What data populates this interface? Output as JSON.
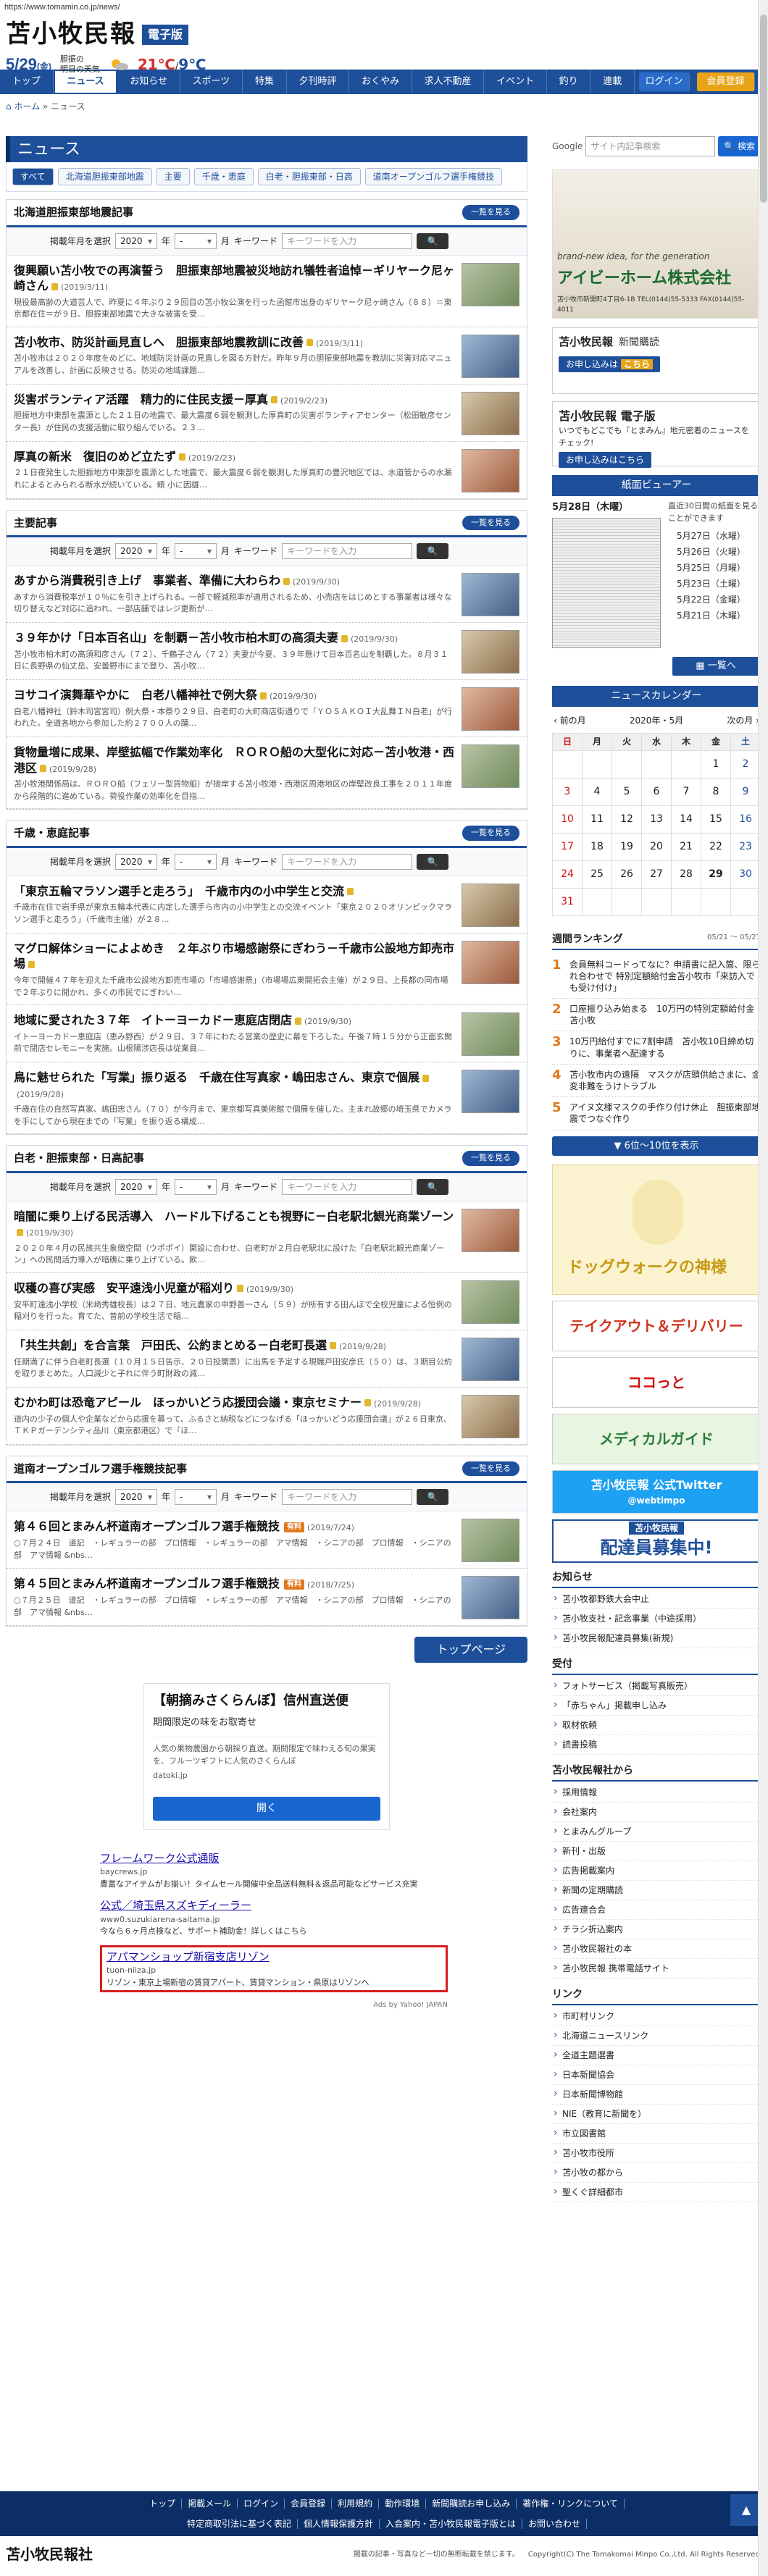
{
  "url": "https://www.tomamin.co.jp/news/",
  "header": {
    "logo_main": "苫小牧民報",
    "logo_badge": "電子版",
    "date": "5/29",
    "weekday": "(金)",
    "weather_src_1": "胆振の",
    "weather_src_2": "明日の天気",
    "temp_high": "21℃",
    "temp_sep": "/",
    "temp_low": "9℃"
  },
  "nav": {
    "items": [
      "トップ",
      "ニュース",
      "お知らせ",
      "スポーツ",
      "特集",
      "夕刊時評",
      "おくやみ",
      "求人不動産",
      "イベント",
      "釣り",
      "連載"
    ],
    "login": "ログイン",
    "member": "会員登録"
  },
  "breadcrumb": {
    "home": "ホーム",
    "sep": "»",
    "current": "ニュース"
  },
  "page_title": "ニュース",
  "subnav": [
    "すべて",
    "北海道胆振東部地震",
    "主要",
    "千歳・恵庭",
    "白老・胆振東部・日高",
    "道南オープンゴルフ選手権競技"
  ],
  "filter": {
    "label": "掲載年月を選択",
    "year": "2020",
    "year_unit": "年",
    "month": "-",
    "month_unit": "月",
    "kw_label": "キーワード",
    "kw_placeholder": "キーワードを入力",
    "list_btn": "一覧を見る"
  },
  "blocks": [
    {
      "title": "北海道胆振東部地震記事",
      "articles": [
        {
          "title": "復興願い苫小牧での再演誓う　胆振東部地震被災地訪れ犠牲者追悼－ギリヤーク尼ヶ崎さん",
          "date": "(2019/3/11)",
          "lock": true,
          "summary": "現役最高齢の大道芸人で、昨夏に４年ぶり２９回目の苫小牧公演を行った函館市出身のギリヤーク尼ヶ崎さん（８８）＝東京都在住＝が９日、胆振東部地震で大きな被害を受…"
        },
        {
          "title": "苫小牧市、防災計画見直しへ　胆振東部地震教訓に改善",
          "date": "(2019/3/11)",
          "lock": true,
          "summary": "苫小牧市は２０２０年度をめどに、地域防災計画の見直しを図る方針だ。昨年９月の胆振東部地震を教訓に災害対応マニュアルを改善し、計画に反映させる。防災の地域課題…"
        },
        {
          "title": "災害ボランティア活躍　精力的に住民支援－厚真",
          "date": "(2019/2/23)",
          "lock": true,
          "summary": "胆振地方中東部を震源とした２１日の地震で、最大震度６弱を観測した厚真町の災害ボランティアセンター（松田敏彦センター長）が住民の支援活動に取り組んでいる。２３…"
        },
        {
          "title": "厚真の新米　復旧のめど立たず",
          "date": "(2019/2/23)",
          "lock": true,
          "summary": "２１日夜発生した胆振地方中東部を震源とした地震で、最大震度６弱を観測した厚真町の豊沢地区では、水道管からの水漏れによるとみられる断水が続いている。頼 小に因雄…"
        }
      ]
    },
    {
      "title": "主要記事",
      "articles": [
        {
          "title": "あすから消費税引き上げ　事業者、準備に大わらわ",
          "date": "(2019/9/30)",
          "lock": true,
          "summary": "あすから消費税率が１０％にを引き上げられる。一部で軽減税率が適用されるため、小売店をはじめとする事業者は様々な切り替えなど対応に追われ、一部店舗ではレジ更新が…"
        },
        {
          "title": "３９年かけ「日本百名山」を制覇－苫小牧市柏木町の高須夫妻",
          "date": "(2019/9/30)",
          "lock": true,
          "summary": "苫小牧市柏木町の高須和彦さん（７２）、千鶴子さん（７２）夫妻が今夏、３９年懸けて日本百名山を制覇した。８月３１日に長野県の仙丈岳、安曇野市にまで登り、苫小牧…"
        },
        {
          "title": "ヨサコイ演舞華やかに　白老八幡神社で例大祭",
          "date": "(2019/9/30)",
          "lock": true,
          "summary": "白老八幡神社（鈴木司宮宮司）例大祭・本祭り２９日、白老町の大町商店街通りで「ＹＯＳＡＫＯＩ大乱舞ＩＮ白老」が行われた。全道各地から参加した約２７００人の踊…"
        },
        {
          "title": "貨物量増に成果、岸壁拡幅で作業効率化　ＲＯＲＯ船の大型化に対応－苫小牧港・西港区",
          "date": "(2019/9/28)",
          "lock": true,
          "summary": "苫小牧港関係局は、ＲＯＲＯ船（フェリー型貨物船）が接岸する苫小牧港・西港区周港地区の岸壁改良工事を２０１１年度から段階的に進めている。荷役作業の効率化を目指…"
        }
      ]
    },
    {
      "title": "千歳・恵庭記事",
      "articles": [
        {
          "title": "「東京五輪マラソン選手と走ろう」　千歳市内の小中学生と交流",
          "date": "",
          "lock": true,
          "summary": "千歳市在住で岩手県が東京五輪本代表に内定した選手ら市内の小中学生との交流イベント「東京２０２０オリンピックマラソン選手と走ろう」（千歳市主催）が２８…"
        },
        {
          "title": "マグロ解体ショーによよめき　２年ぶり市場感謝祭にぎわう－千歳市公設地方卸売市場",
          "date": "",
          "lock": true,
          "summary": "今年で開催４７年を迎えた千歳市公設地方卸売市場の「市場感謝祭」（市場場広東開拓会主催）が２９日、上長都の同市場で２年ぶりに開かれ、多くの市民でにぎわい…"
        },
        {
          "title": "地域に愛された３７年　イトーヨーカドー恵庭店閉店",
          "date": "(2019/9/30)",
          "lock": true,
          "summary": "イトーヨーカドー恵庭店（恵み野西）が２９日、３７年にわたる営業の歴史に幕を下ろした。午後７時１５分から正面玄関前で閉店セレモニーを実施。山根陽渉店長は従業員…"
        },
        {
          "title": "鳥に魅せられた「写業」振り返る　千歳在住写真家・嶋田忠さん、東京で個展",
          "date": "(2019/9/28)",
          "lock": true,
          "summary": "千歳在住の自然写真家、嶋田忠さん（７０）が今月まで、東京都写真美術館で個展を催した。主まれ故郷の埼玉県でカメラを手にしてから現在までの「写業」を振り返る構成…"
        }
      ]
    },
    {
      "title": "白老・胆振東部・日高記事",
      "articles": [
        {
          "title": "暗闇に乗り上げる民活導入　ハードル下げることも視野に－白老駅北観光商業ゾーン",
          "date": "(2019/9/30)",
          "lock": true,
          "summary": "２０２０年４月の民族共生象徴空間（ウポポイ）開設に合わせ、白老町が２月白老駅北に設けた「白老駅北観光商業ゾーン」への民間活力導入が暗礁に乗り上げている。飲…"
        },
        {
          "title": "収穫の喜び実感　安平遠浅小児童が稲刈り",
          "date": "(2019/9/30)",
          "lock": true,
          "summary": "安平町遠浅小学校（米崎秀雄校長）は２７日、地元農家の中野善一さん（５９）が所有する田んぼで全校児童による恒例の稲刈りを行った。育てた、昔前の学校生活で稲…"
        },
        {
          "title": "「共生共創」を合言葉　戸田氏、公約まとめる－白老町長選",
          "date": "(2019/9/28)",
          "lock": true,
          "summary": "任期満了に伴う白老町長選（１０月１５日告示、２０日投開票）に出馬を予定する現職戸田安彦氏（５０）は、３期目公約を取りまとめた。人口減少と子れに伴う町財政の減…"
        },
        {
          "title": "むかわ町は恐竜アピール　ほっかいどう応援団会議・東京セミナー",
          "date": "(2019/9/28)",
          "lock": true,
          "summary": "道内の少子の個人や企業などから応援を募って、ふるさと納税などにつなげる「ほっかいどう応援団会議」が２６日東京、ＴＫＰガーデンシティ品川（東京都港区）で「ほ…"
        }
      ]
    },
    {
      "title": "道南オープンゴルフ選手権競技記事",
      "articles": [
        {
          "title": "第４６回とまみん杯道南オープンゴルフ選手権競技",
          "date": "(2019/7/24)",
          "lock": false,
          "paid": "有料",
          "summary": "○７月２４日　道記　・レギュラーの部　プロ情報　・レギュラーの部　アマ情報　・シニアの部　プロ情報　・シニアの部　アマ情報 &nbs…"
        },
        {
          "title": "第４５回とまみん杯道南オープンゴルフ選手権競技",
          "date": "(2018/7/25)",
          "lock": false,
          "paid": "有料",
          "summary": "○７月２５日　道記　・レギュラーの部　プロ情報　・レギュラーの部　アマ情報　・シニアの部　プロ情報　・シニアの部　アマ情報 &nbs…"
        }
      ]
    }
  ],
  "top_page_btn": "トップページ",
  "ad1": {
    "title": "【朝摘みさくらんぼ】信州直送便",
    "sub": "期間限定の味をお取寄せ",
    "body": "人気の果物農園から朝採り直送。期間限定で味わえる旬の果実を、フルーツギフトに人気のさくらんぼ",
    "url": "datoki.jp",
    "btn": "開く"
  },
  "ydn": [
    {
      "title": "フレームワーク公式通販",
      "url": "baycrews.jp",
      "desc": "豊富なアイテムがお揃い！タイムセール開催中全品送料無料＆返品可能などサービス充実"
    },
    {
      "title": "公式／埼玉県スズキディーラー",
      "url": "www0.suzukiarena-saitama.jp",
      "desc": "今なら６ヶ月点検など、サポート補助金！詳しくはこちら"
    },
    {
      "title": "アパマンショップ新宿支店リゾン",
      "url": "tuon-niiza.jp",
      "desc": "リゾン・東京上場新宿の賃貸アパート、賃貸マンション・県原はリゾンへ"
    }
  ],
  "ydn_src": "Ads by Yahoo! JAPAN",
  "side": {
    "google": "Google",
    "search_placeholder": "サイト内記事検索",
    "search_btn": "検索",
    "ad_tag": "brand-new idea, for the generation",
    "ad_brand": "アイビーホーム株式会社",
    "ad_tel": "苫小牧市新開町4丁目6-1B TEL(0144)55-5333 FAX(0144)55-4011",
    "subscribe_logo": "苫小牧民報",
    "subscribe_title": "新聞購読",
    "subscribe_cta": "お申し込みは",
    "subscribe_cta_b": "こちら",
    "digital_logo": "苫小牧民報 電子版",
    "digital_desc": "いつでもどこでも『とまみん』地元密着のニュースをチェック!",
    "digital_cta": "お申し込みはこちら",
    "viewer_head": "紙面ビューアー",
    "viewer_today": "5月28日（木曜）",
    "viewer_note": "直近30日間の紙面を見ることができます",
    "viewer_dates": [
      "5月27日（水曜）",
      "5月26日（火曜）",
      "5月25日（月曜）",
      "5月23日（土曜）",
      "5月22日（金曜）",
      "5月21日（木曜）"
    ],
    "viewer_list_btn": "一覧へ",
    "cal_head": "ニュースカレンダー",
    "cal_prev": "‹ 前の月",
    "cal_month": "2020年・5月",
    "cal_next": "次の月 ›",
    "cal_weekdays": [
      "日",
      "月",
      "火",
      "水",
      "木",
      "金",
      "土"
    ],
    "cal_rows": [
      [
        "",
        "",
        "",
        "",
        "",
        "1",
        "2"
      ],
      [
        "3",
        "4",
        "5",
        "6",
        "7",
        "8",
        "9"
      ],
      [
        "10",
        "11",
        "12",
        "13",
        "14",
        "15",
        "16"
      ],
      [
        "17",
        "18",
        "19",
        "20",
        "21",
        "22",
        "23"
      ],
      [
        "24",
        "25",
        "26",
        "27",
        "28",
        "29",
        "30"
      ],
      [
        "31",
        "",
        "",
        "",
        "",
        "",
        ""
      ]
    ],
    "rank_title": "週間ランキング",
    "rank_range": "05/21 〜 05/27",
    "rank": [
      "会員無料コードってなに？申請書に記入箇、限られ合わせで 特別定額給付金苫小牧市「来訪入でも受け付け」",
      "口座振り込み始まる　10万円の特別定額給付金 苫小牧",
      "10万円給付すでに7割申請　苫小牧10日締め切りに、事業者へ配達する",
      "苫小牧市内の遠隔　マスクが店頭供給さまに、金変非難をうけトラブル",
      "アイヌ文様マスクの手作り付け休止　胆振東部地震でつなぐ作り"
    ],
    "rank_more": "6位〜10位を表示",
    "dog_title": "ドッグウォークの神様",
    "takeout": "テイクアウト＆デリバリー",
    "kokotto": "ココっと",
    "medical": "メディカルガイド",
    "twitter_1": "苫小牧民報 公式Twitter",
    "twitter_2": "@webtimpo",
    "haitatsu_h": "苫小牧民報",
    "haitatsu_b": "配達員募集中!",
    "notice_h": "お知らせ",
    "notice": [
      "苫小牧都野鉄大会中止",
      "苫小牧支社・記念事業（中途採用）",
      "苫小牧民報配達員募集(新規)"
    ],
    "uketsuke_h": "受付",
    "uketsuke": [
      "フォトサービス（掲載写真販売）",
      "「赤ちゃん」掲載申し込み",
      "取材依頼",
      "読書投稿"
    ],
    "company_h": "苫小牧民報社から",
    "company": [
      "採用情報",
      "会社案内",
      "とまみんグループ",
      "新刊・出版",
      "広告掲載案内",
      "新聞の定期購読",
      "広告連合会",
      "チラシ折込案内",
      "苫小牧民報社の本",
      "苫小牧民報 携帯電話サイト"
    ],
    "link_h": "リンク",
    "links": [
      "市町村リンク",
      "北海道ニュースリンク",
      "全道主題選書",
      "日本新聞協会",
      "日本新聞博物館",
      "NIE（教育に新聞を）",
      "市立図書館",
      "苫小牧市役所",
      "苫小牧の都から",
      "聖くぐ詳細都市"
    ]
  },
  "footer": {
    "row1": [
      "トップ",
      "掲載メール",
      "ログイン",
      "会員登録",
      "利用規約",
      "動作環境",
      "新聞購読お申し込み",
      "著作権・リンクについて"
    ],
    "row2": [
      "特定商取引法に基づく表記",
      "個人情報保護方針",
      "入会案内・苫小牧民報電子版とは",
      "お問い合わせ"
    ],
    "logo": "苫小牧民報社",
    "disclaimer": "掲載の記事・写真など一切の無断転載を禁じます。",
    "copyright": "Copyright(C) The Tomakomai Minpo Co.,Ltd. All Rights Reserved."
  }
}
